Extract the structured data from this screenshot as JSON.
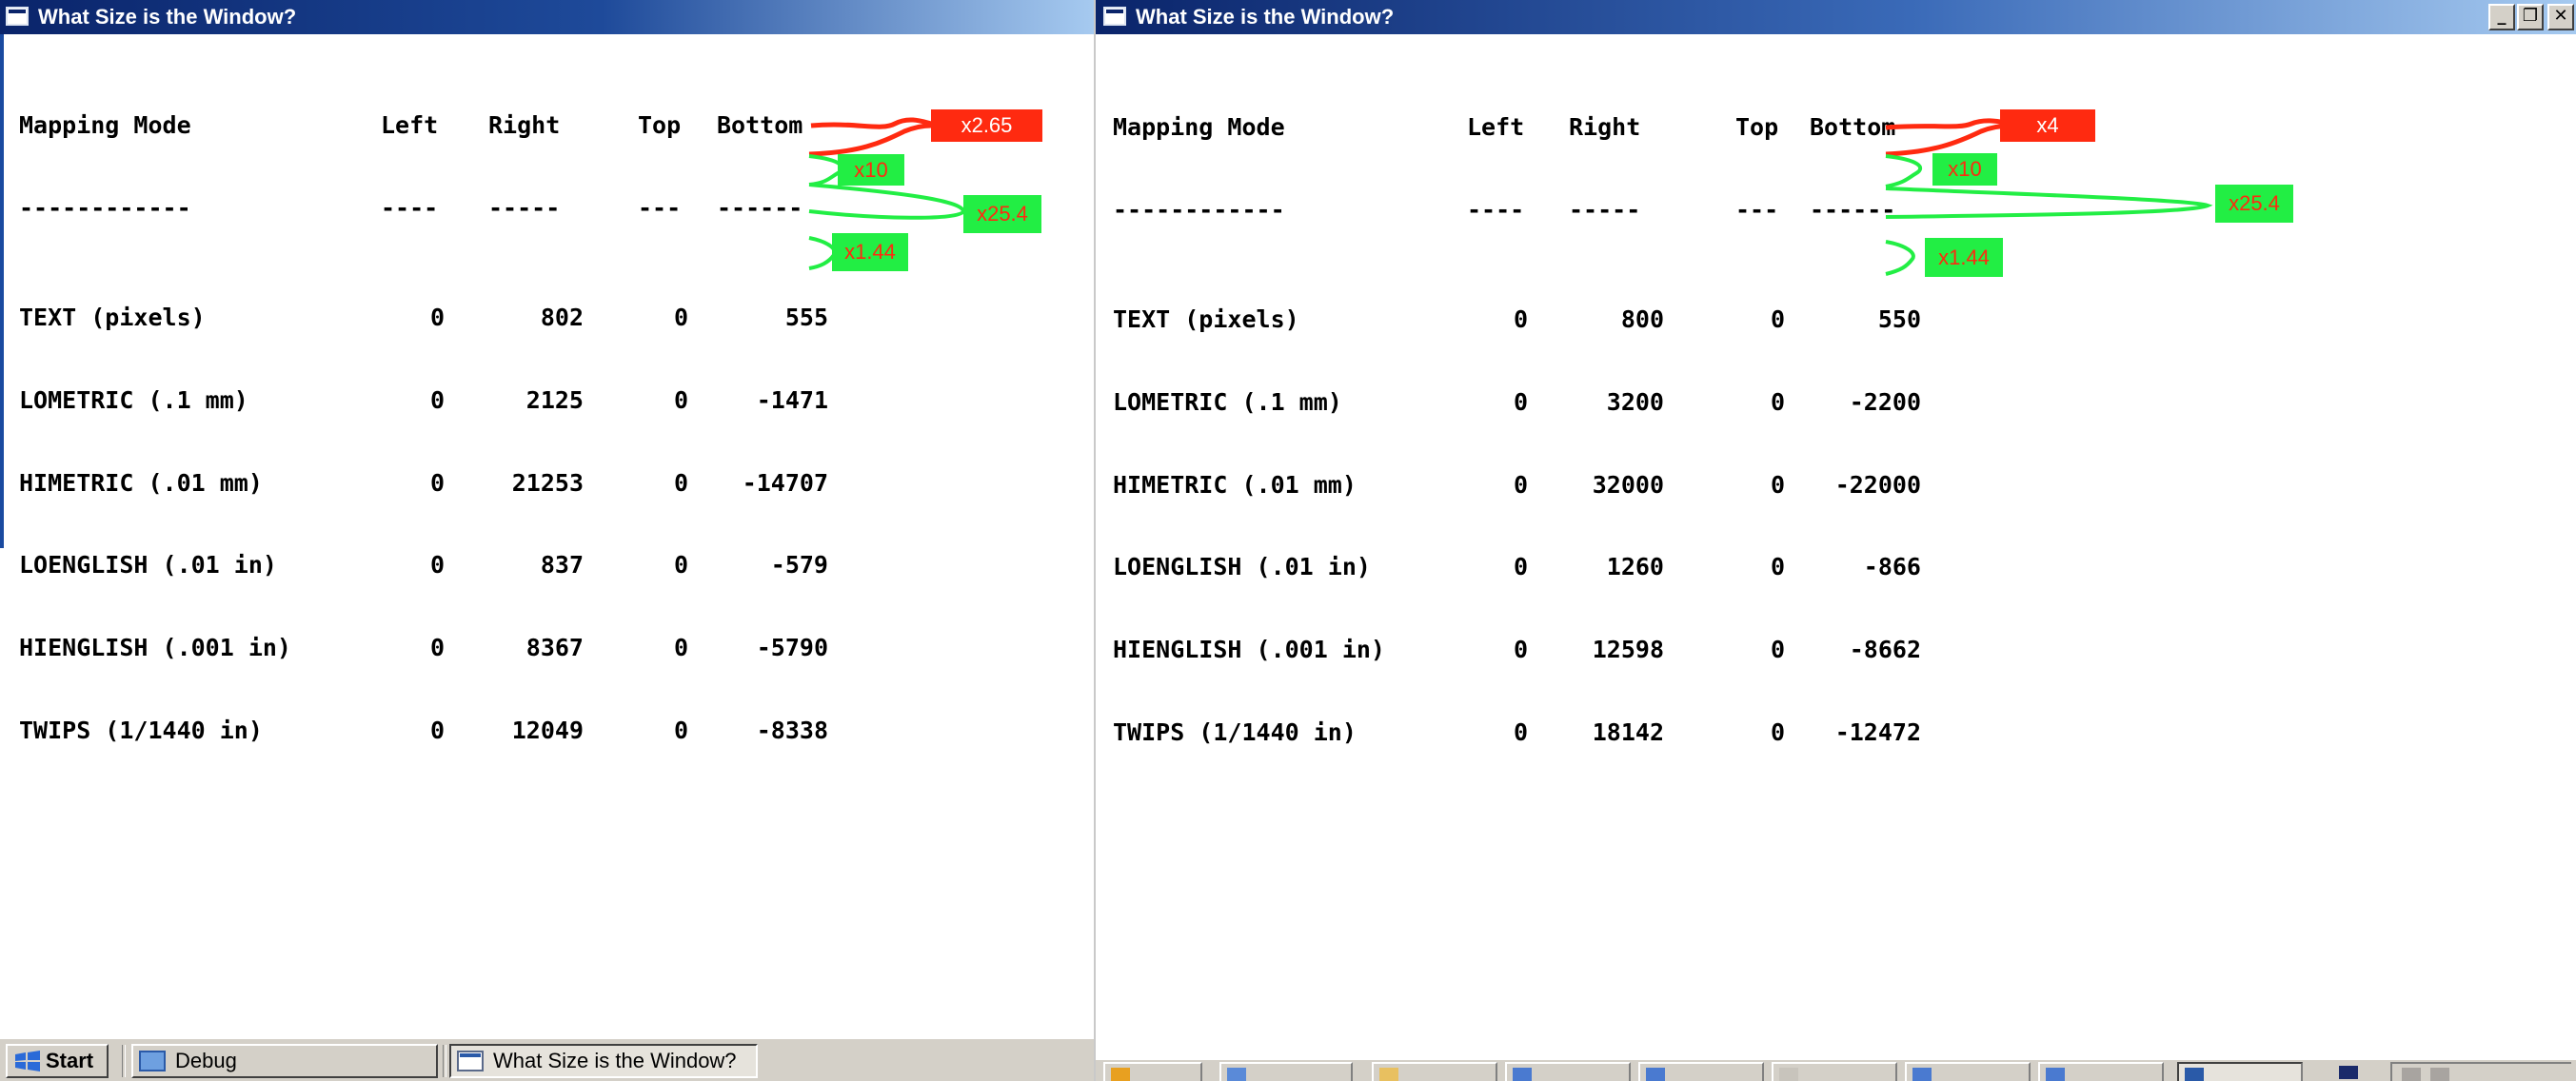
{
  "left_window": {
    "title": "What Size is the Window?",
    "headers": {
      "mode": "Mapping Mode",
      "left": "Left",
      "right": "Right",
      "top": "Top",
      "bottom": "Bottom"
    },
    "underlines": {
      "mode": "------------",
      "left": "----",
      "right": "-----",
      "top": "---",
      "bottom": "------"
    },
    "rows": [
      {
        "mode": "TEXT (pixels)",
        "left": "0",
        "right": "802",
        "top": "0",
        "bottom": "555"
      },
      {
        "mode": "LOMETRIC (.1 mm)",
        "left": "0",
        "right": "2125",
        "top": "0",
        "bottom": "-1471"
      },
      {
        "mode": "HIMETRIC (.01 mm)",
        "left": "0",
        "right": "21253",
        "top": "0",
        "bottom": "-14707"
      },
      {
        "mode": "LOENGLISH (.01 in)",
        "left": "0",
        "right": "837",
        "top": "0",
        "bottom": "-579"
      },
      {
        "mode": "HIENGLISH (.001 in)",
        "left": "0",
        "right": "8367",
        "top": "0",
        "bottom": "-5790"
      },
      {
        "mode": "TWIPS (1/1440 in)",
        "left": "0",
        "right": "12049",
        "top": "0",
        "bottom": "-8338"
      }
    ],
    "annotations": {
      "text_to_lometric": "x2.65",
      "lometric_to_himetric": "x10",
      "loenglish_to_himetric": "x25.4",
      "hienglish_to_twips": "x1.44"
    }
  },
  "right_window": {
    "title": "What Size is the Window?",
    "controls": {
      "minimize": "_",
      "restore": "❐",
      "close": "✕"
    },
    "headers": {
      "mode": "Mapping Mode",
      "left": "Left",
      "right": "Right",
      "top": "Top",
      "bottom": "Bottom"
    },
    "underlines": {
      "mode": "------------",
      "left": "----",
      "right": "-----",
      "top": "---",
      "bottom": "------"
    },
    "rows": [
      {
        "mode": "TEXT (pixels)",
        "left": "0",
        "right": "800",
        "top": "0",
        "bottom": "550"
      },
      {
        "mode": "LOMETRIC (.1 mm)",
        "left": "0",
        "right": "3200",
        "top": "0",
        "bottom": "-2200"
      },
      {
        "mode": "HIMETRIC (.01 mm)",
        "left": "0",
        "right": "32000",
        "top": "0",
        "bottom": "-22000"
      },
      {
        "mode": "LOENGLISH (.01 in)",
        "left": "0",
        "right": "1260",
        "top": "0",
        "bottom": "-866"
      },
      {
        "mode": "HIENGLISH (.001 in)",
        "left": "0",
        "right": "12598",
        "top": "0",
        "bottom": "-8662"
      },
      {
        "mode": "TWIPS (1/1440 in)",
        "left": "0",
        "right": "18142",
        "top": "0",
        "bottom": "-12472"
      }
    ],
    "annotations": {
      "text_to_lometric": "x4",
      "lometric_to_himetric": "x10",
      "loenglish_to_himetric": "x25.4",
      "hienglish_to_twips": "x1.44"
    }
  },
  "taskbar": {
    "start_label": "Start",
    "buttons": [
      {
        "label": "Debug",
        "icon": "folder-icon",
        "active": false
      },
      {
        "label": "What Size is the Window?",
        "icon": "window-icon",
        "active": true
      }
    ]
  },
  "colors": {
    "title_active": "#0a246a",
    "annotation_red": "#ff2a10",
    "annotation_green": "#22ee44",
    "taskbar_face": "#d4d0c8"
  }
}
